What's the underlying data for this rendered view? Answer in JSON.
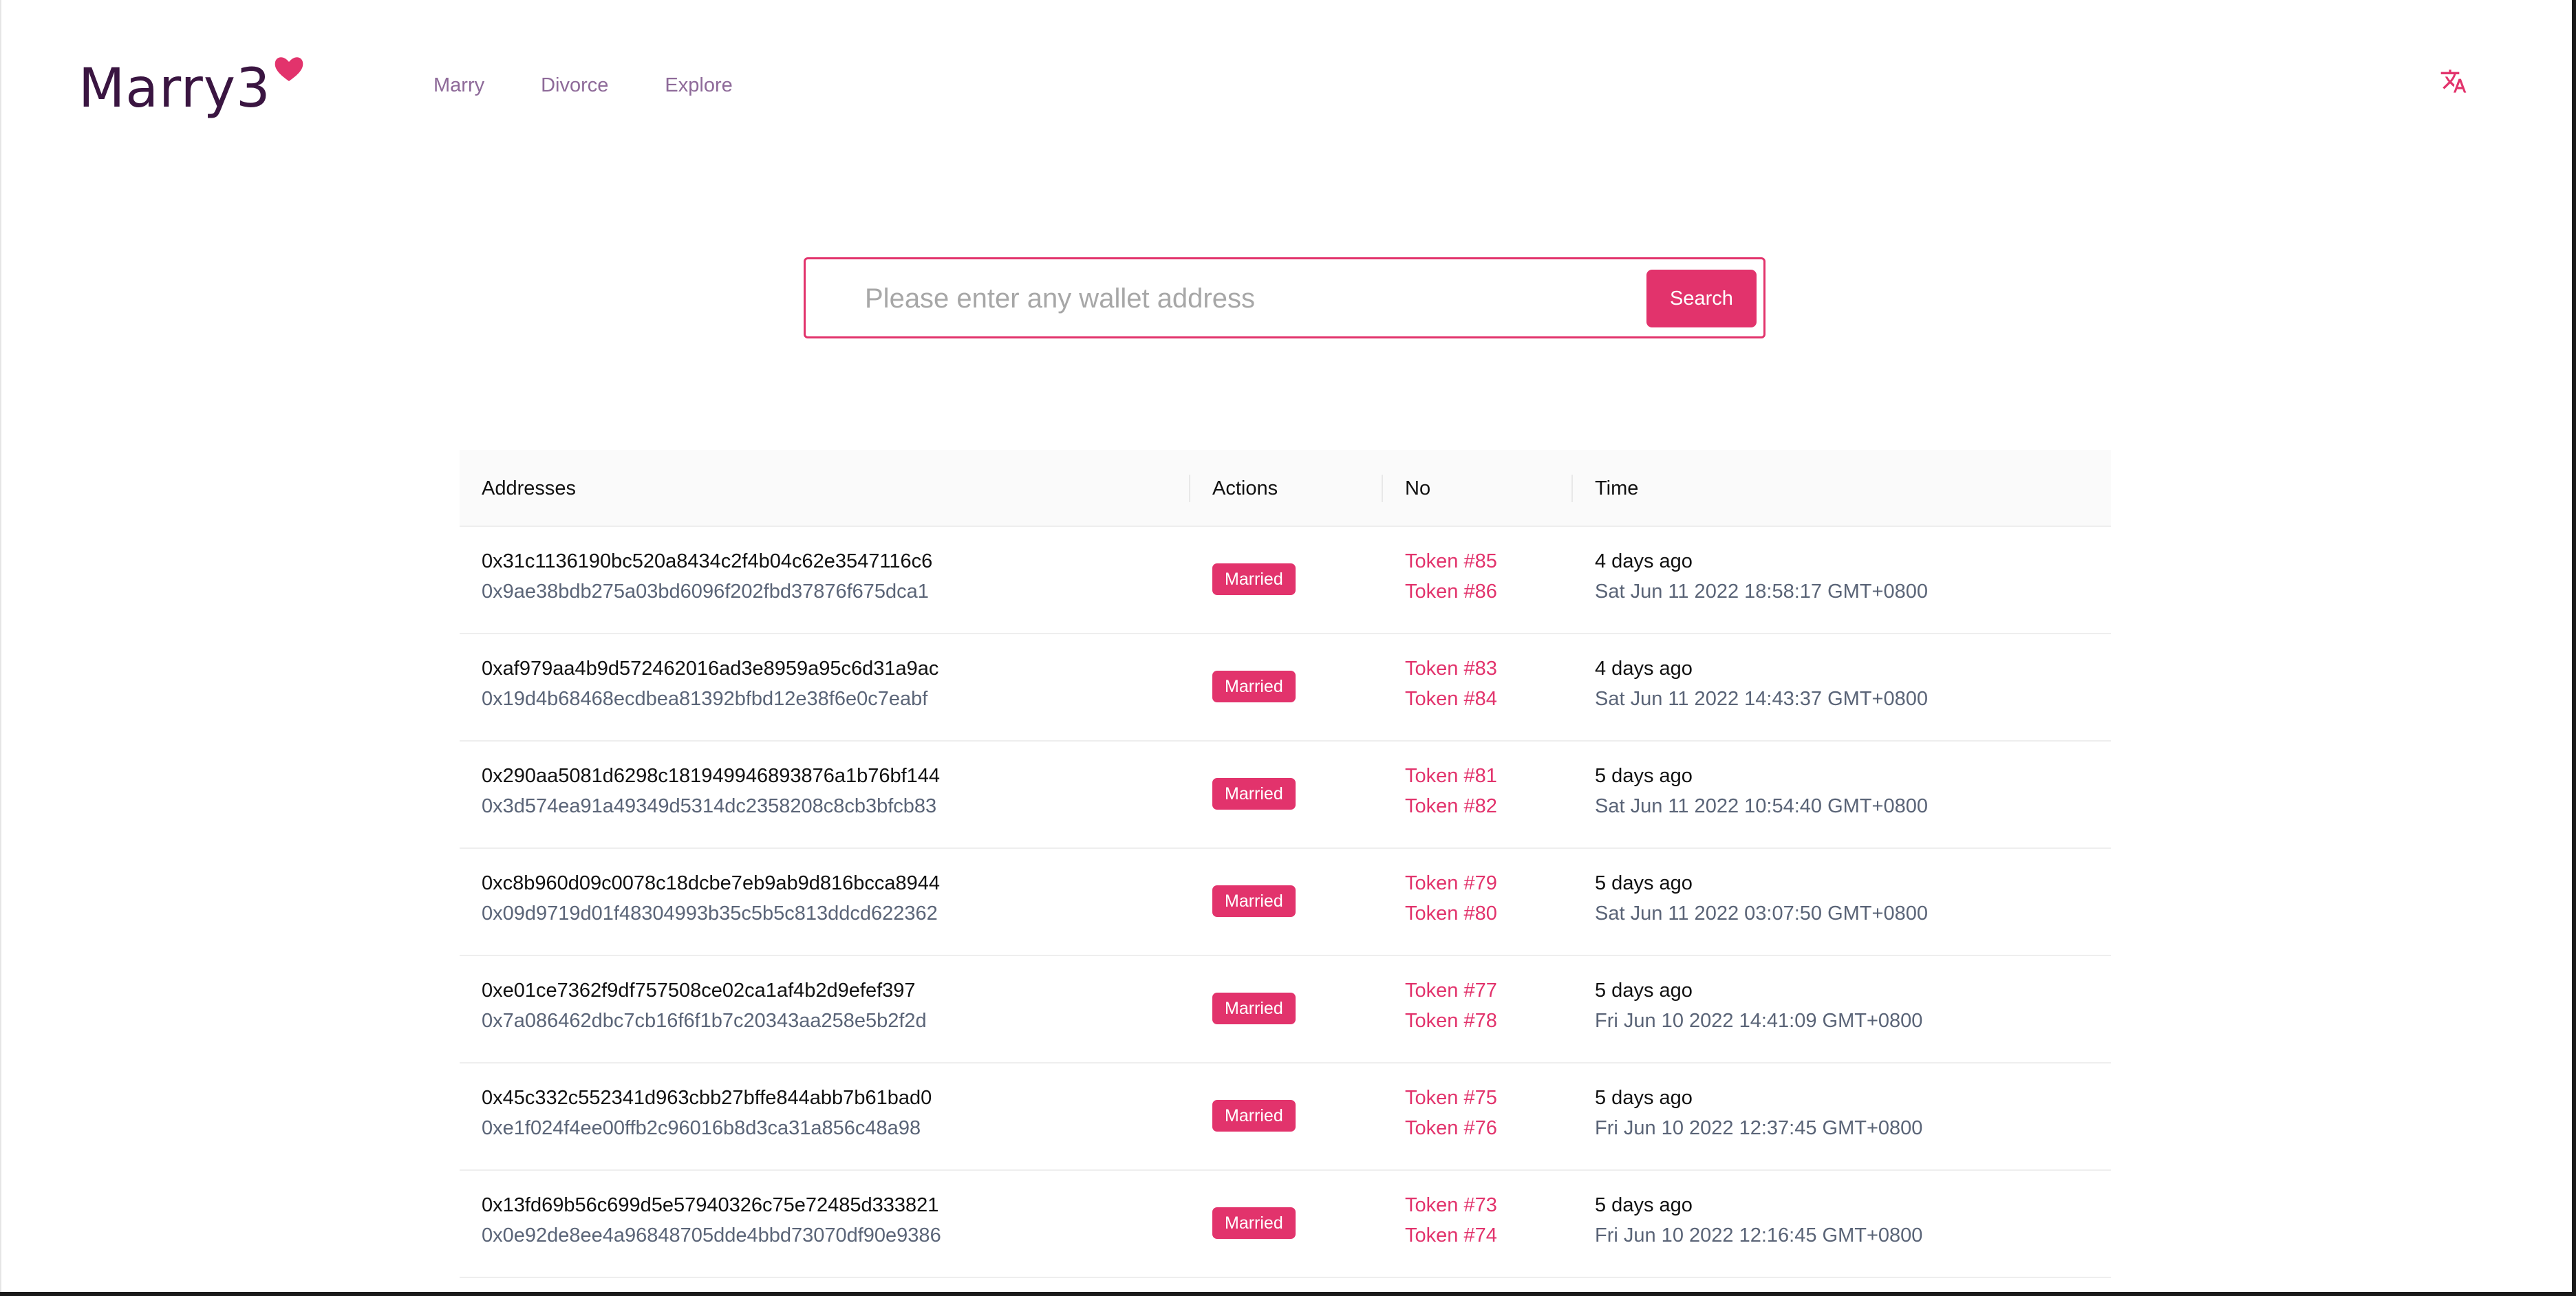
{
  "brand": {
    "logo_text": "Marry3",
    "accent_color": "#e2336c",
    "logo_color": "#3a1541"
  },
  "nav": {
    "items": [
      {
        "label": "Marry"
      },
      {
        "label": "Divorce"
      },
      {
        "label": "Explore"
      }
    ],
    "language_icon": "translate-icon"
  },
  "search": {
    "placeholder": "Please enter any wallet address",
    "value": "",
    "button_label": "Search"
  },
  "table": {
    "columns": [
      "Addresses",
      "Actions",
      "No",
      "Time"
    ],
    "rows": [
      {
        "address_a": "0x31c1136190bc520a8434c2f4b04c62e3547116c6",
        "address_b": "0x9ae38bdb275a03bd6096f202fbd37876f675dca1",
        "action": "Married",
        "token_a": "Token #85",
        "token_b": "Token #86",
        "time_relative": "4 days ago",
        "time_absolute": "Sat Jun 11 2022 18:58:17 GMT+0800"
      },
      {
        "address_a": "0xaf979aa4b9d572462016ad3e8959a95c6d31a9ac",
        "address_b": "0x19d4b68468ecdbea81392bfbd12e38f6e0c7eabf",
        "action": "Married",
        "token_a": "Token #83",
        "token_b": "Token #84",
        "time_relative": "4 days ago",
        "time_absolute": "Sat Jun 11 2022 14:43:37 GMT+0800"
      },
      {
        "address_a": "0x290aa5081d6298c181949946893876a1b76bf144",
        "address_b": "0x3d574ea91a49349d5314dc2358208c8cb3bfcb83",
        "action": "Married",
        "token_a": "Token #81",
        "token_b": "Token #82",
        "time_relative": "5 days ago",
        "time_absolute": "Sat Jun 11 2022 10:54:40 GMT+0800"
      },
      {
        "address_a": "0xc8b960d09c0078c18dcbe7eb9ab9d816bcca8944",
        "address_b": "0x09d9719d01f48304993b35c5b5c813ddcd622362",
        "action": "Married",
        "token_a": "Token #79",
        "token_b": "Token #80",
        "time_relative": "5 days ago",
        "time_absolute": "Sat Jun 11 2022 03:07:50 GMT+0800"
      },
      {
        "address_a": "0xe01ce7362f9df757508ce02ca1af4b2d9efef397",
        "address_b": "0x7a086462dbc7cb16f6f1b7c20343aa258e5b2f2d",
        "action": "Married",
        "token_a": "Token #77",
        "token_b": "Token #78",
        "time_relative": "5 days ago",
        "time_absolute": "Fri Jun 10 2022 14:41:09 GMT+0800"
      },
      {
        "address_a": "0x45c332c552341d963cbb27bffe844abb7b61bad0",
        "address_b": "0xe1f024f4ee00ffb2c96016b8d3ca31a856c48a98",
        "action": "Married",
        "token_a": "Token #75",
        "token_b": "Token #76",
        "time_relative": "5 days ago",
        "time_absolute": "Fri Jun 10 2022 12:37:45 GMT+0800"
      },
      {
        "address_a": "0x13fd69b56c699d5e57940326c75e72485d333821",
        "address_b": "0x0e92de8ee4a96848705dde4bbd73070df90e9386",
        "action": "Married",
        "token_a": "Token #73",
        "token_b": "Token #74",
        "time_relative": "5 days ago",
        "time_absolute": "Fri Jun 10 2022 12:16:45 GMT+0800"
      }
    ]
  }
}
